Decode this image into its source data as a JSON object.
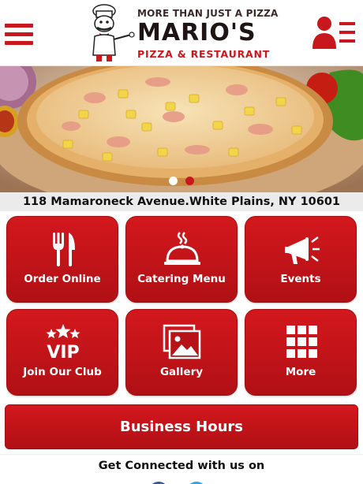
{
  "header": {
    "logo": {
      "tagline": "MORE THAN JUST A PIZZA",
      "name": "MARIO'S",
      "subtitle": "PIZZA & RESTAURANT"
    }
  },
  "address": "118 Mamaroneck Avenue.White Plains, NY 10601",
  "carousel": {
    "slide_count": 2,
    "active_index": 0
  },
  "tiles": [
    {
      "label": "Order Online",
      "icon": "fork-knife-icon"
    },
    {
      "label": "Catering Menu",
      "icon": "cloche-icon"
    },
    {
      "label": "Events",
      "icon": "megaphone-icon"
    },
    {
      "label": "Join Our Club",
      "icon": "vip-icon"
    },
    {
      "label": "Gallery",
      "icon": "gallery-icon"
    },
    {
      "label": "More",
      "icon": "grid-icon"
    }
  ],
  "business_hours_label": "Business Hours",
  "footer": {
    "title": "Get Connected with us on"
  },
  "colors": {
    "brand_red": "#c8171d",
    "address_bar_bg": "#ebebeb"
  }
}
